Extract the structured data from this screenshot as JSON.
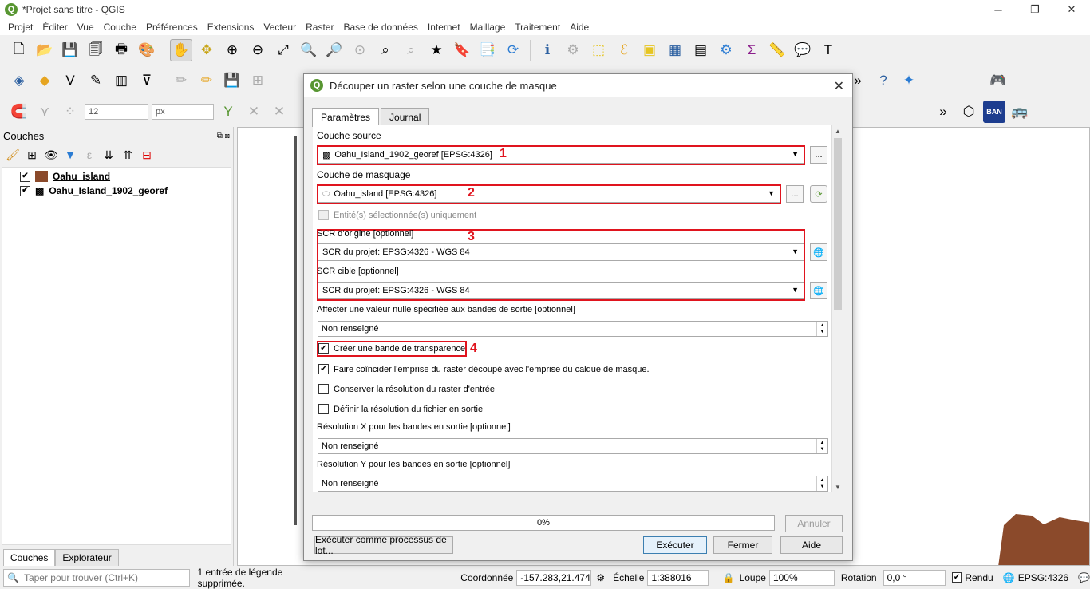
{
  "window": {
    "title": "*Projet sans titre - QGIS",
    "app_icon": "Q"
  },
  "menu": [
    "Projet",
    "Éditer",
    "Vue",
    "Couche",
    "Préférences",
    "Extensions",
    "Vecteur",
    "Raster",
    "Base de données",
    "Internet",
    "Maillage",
    "Traitement",
    "Aide"
  ],
  "toolbar3": {
    "size_value": "12",
    "unit_value": "px",
    "ban_label": "BAN"
  },
  "layers": {
    "title": "Couches",
    "items": [
      {
        "name": "Oahu_island",
        "checked": "✔",
        "swatch": "#8b4a2b"
      },
      {
        "name": "Oahu_Island_1902_georef",
        "checked": "✔"
      }
    ],
    "tabs": [
      "Couches",
      "Explorateur"
    ]
  },
  "dialog": {
    "title": "Découper un raster selon une couche de masque",
    "tabs": [
      "Paramètres",
      "Journal"
    ],
    "source_label": "Couche source",
    "source_value": "Oahu_Island_1902_georef [EPSG:4326]",
    "mask_label": "Couche de masquage",
    "mask_value": "Oahu_island [EPSG:4326]",
    "selected_only": "Entité(s) sélectionnée(s) uniquement",
    "src_crs_label": "SCR d'origine [optionnel]",
    "src_crs_value": "SCR du projet: EPSG:4326 - WGS 84",
    "tgt_crs_label": "SCR cible [optionnel]",
    "tgt_crs_value": "SCR du projet: EPSG:4326 - WGS 84",
    "nodata_label": "Affecter une valeur nulle spécifiée aux bandes de sortie [optionnel]",
    "nodata_value": "Non renseigné",
    "alpha_label": "Créer une bande de transparence",
    "crop_label": "Faire coïncider l'emprise du raster découpé avec l'emprise du calque de masque.",
    "keep_res_label": "Conserver la résolution du raster d'entrée",
    "set_res_label": "Définir la résolution du fichier en sortie",
    "xres_label": "Résolution X pour les bandes en sortie [optionnel]",
    "xres_value": "Non renseigné",
    "yres_label": "Résolution Y pour les bandes en sortie [optionnel]",
    "yres_value": "Non renseigné",
    "progress_text": "0%",
    "progress": 0,
    "cancel_label": "Annuler",
    "batch_label": "Exécuter comme processus de lot...",
    "run_label": "Exécuter",
    "close_label": "Fermer",
    "help_label": "Aide",
    "browse_label": "...",
    "check": "✔",
    "annotations": [
      "1",
      "2",
      "3",
      "4"
    ]
  },
  "status": {
    "search_placeholder": "Taper pour trouver (Ctrl+K)",
    "message": "1 entrée de légende supprimée.",
    "coord_label": "Coordonnée",
    "coord_value": "-157.283,21.474",
    "scale_label": "Échelle",
    "scale_value": "1:388016",
    "magnifier_label": "Loupe",
    "magnifier_value": "100%",
    "rotation_label": "Rotation",
    "rotation_value": "0,0 °",
    "render_label": "Rendu",
    "crs_value": "EPSG:4326"
  },
  "colors": {
    "accent_red": "#e0141e",
    "qgis_green": "#589632",
    "island_brown": "#8b4a2b"
  }
}
